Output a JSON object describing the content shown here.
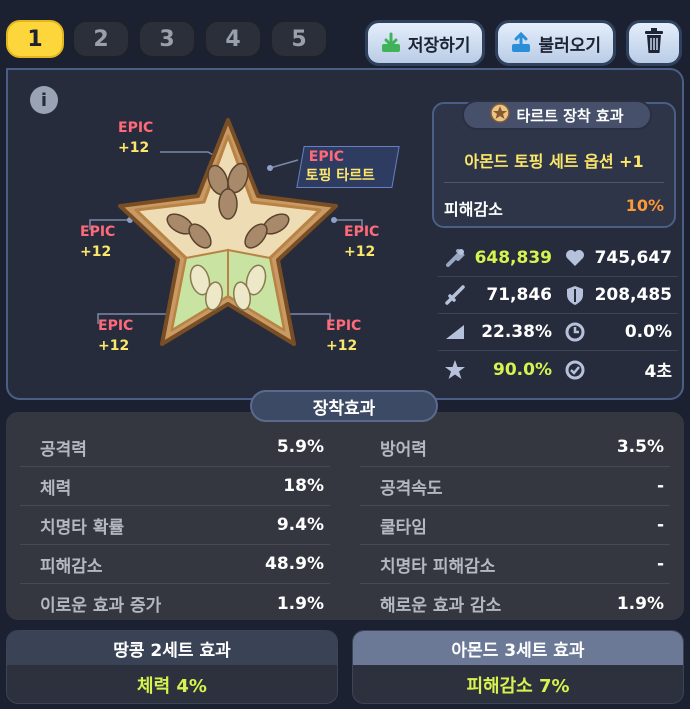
{
  "tabs": [
    "1",
    "2",
    "3",
    "4",
    "5"
  ],
  "active_tab": 0,
  "toolbar": {
    "save_label": "저장하기",
    "load_label": "불러오기"
  },
  "info_label": "i",
  "tart_slots": [
    {
      "grade": "EPIC",
      "level": "+12"
    },
    {
      "grade": "EPIC",
      "level": "+12"
    },
    {
      "grade": "EPIC",
      "level": "+12"
    },
    {
      "grade": "EPIC",
      "level": "+12"
    },
    {
      "grade": "EPIC",
      "level": "+12"
    },
    {
      "grade": "EPIC",
      "level": "+12"
    }
  ],
  "tart_tag": {
    "grade": "EPIC",
    "name": "토핑 타르트"
  },
  "tart_effect": {
    "title": "타르트 장착 효과",
    "subtitle": "아몬드 토핑 세트 옵션 +1",
    "stat_label": "피해감소",
    "stat_value": "10%"
  },
  "stats": [
    {
      "left_icon": "attack-power-icon",
      "left": "648,839",
      "left_color": "#d6f34f",
      "right_icon": "heart-icon",
      "right": "745,647"
    },
    {
      "left_icon": "sword-icon",
      "left": "71,846",
      "left_color": "#ffffff",
      "right_icon": "shield-icon",
      "right": "208,485"
    },
    {
      "left_icon": "crit-icon",
      "left": "22.38%",
      "left_color": "#ffffff",
      "right_icon": "cooldown-icon",
      "right": "0.0%"
    },
    {
      "left_icon": "star-burst-icon",
      "left": "90.0%",
      "left_color": "#d6f34f",
      "right_icon": "clock-check-icon",
      "right": "4초"
    }
  ],
  "equip_title": "장착효과",
  "equip_left": [
    {
      "label": "공격력",
      "value": "5.9%"
    },
    {
      "label": "체력",
      "value": "18%"
    },
    {
      "label": "치명타 확률",
      "value": "9.4%"
    },
    {
      "label": "피해감소",
      "value": "48.9%"
    },
    {
      "label": "이로운 효과 증가",
      "value": "1.9%"
    }
  ],
  "equip_right": [
    {
      "label": "방어력",
      "value": "3.5%"
    },
    {
      "label": "공격속도",
      "value": "-"
    },
    {
      "label": "쿨타임",
      "value": "-"
    },
    {
      "label": "치명타 피해감소",
      "value": "-"
    },
    {
      "label": "해로운 효과 감소",
      "value": "1.9%"
    }
  ],
  "set_effects": [
    {
      "title": "땅콩 2세트 효과",
      "effect": "체력 4%"
    },
    {
      "title": "아몬드 3세트 효과",
      "effect": "피해감소 7%"
    }
  ]
}
